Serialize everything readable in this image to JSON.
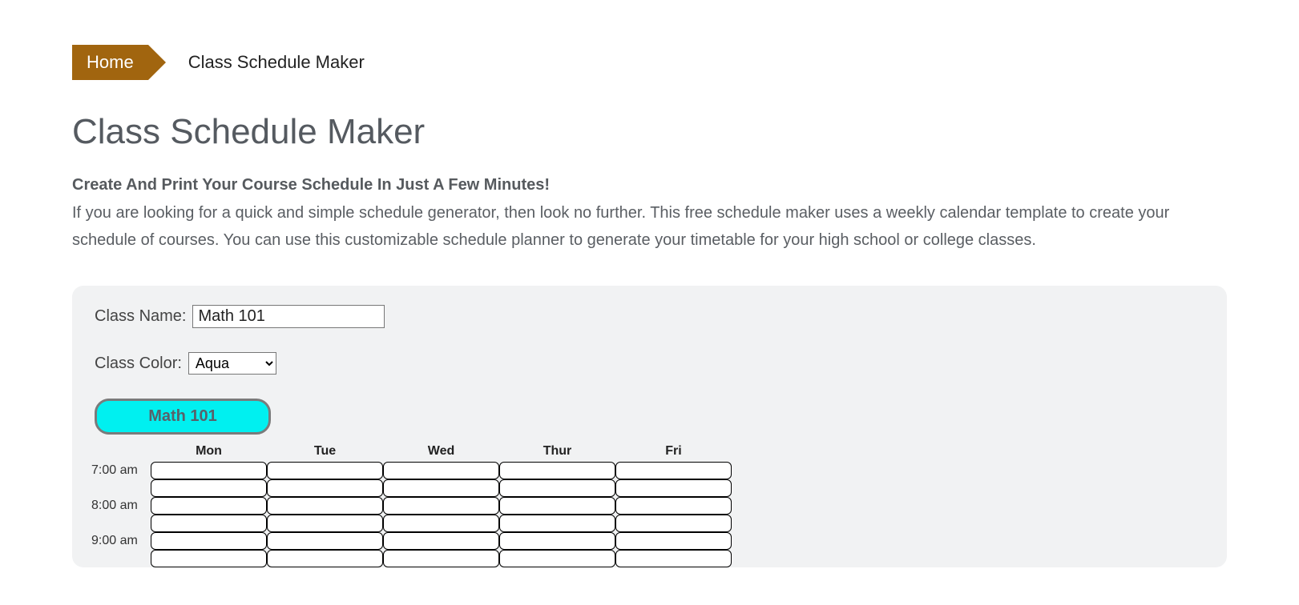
{
  "breadcrumb": {
    "home": "Home",
    "current": "Class Schedule Maker"
  },
  "title": "Class Schedule Maker",
  "subhead": "Create And Print Your Course Schedule In Just A Few Minutes!",
  "desc": "If you are looking for a quick and simple schedule generator, then look no further. This free schedule maker uses a weekly calendar template to create your schedule of courses. You can use this customizable schedule planner to generate your timetable for your high school or college classes.",
  "form": {
    "class_name_label": "Class Name:",
    "class_name_value": "Math 101",
    "class_color_label": "Class Color:",
    "class_color_value": "Aqua"
  },
  "chip": {
    "label": "Math 101",
    "color": "#00f0f0"
  },
  "schedule": {
    "days": [
      "Mon",
      "Tue",
      "Wed",
      "Thur",
      "Fri"
    ],
    "times": [
      "7:00 am",
      "8:00 am",
      "9:00 am"
    ]
  }
}
